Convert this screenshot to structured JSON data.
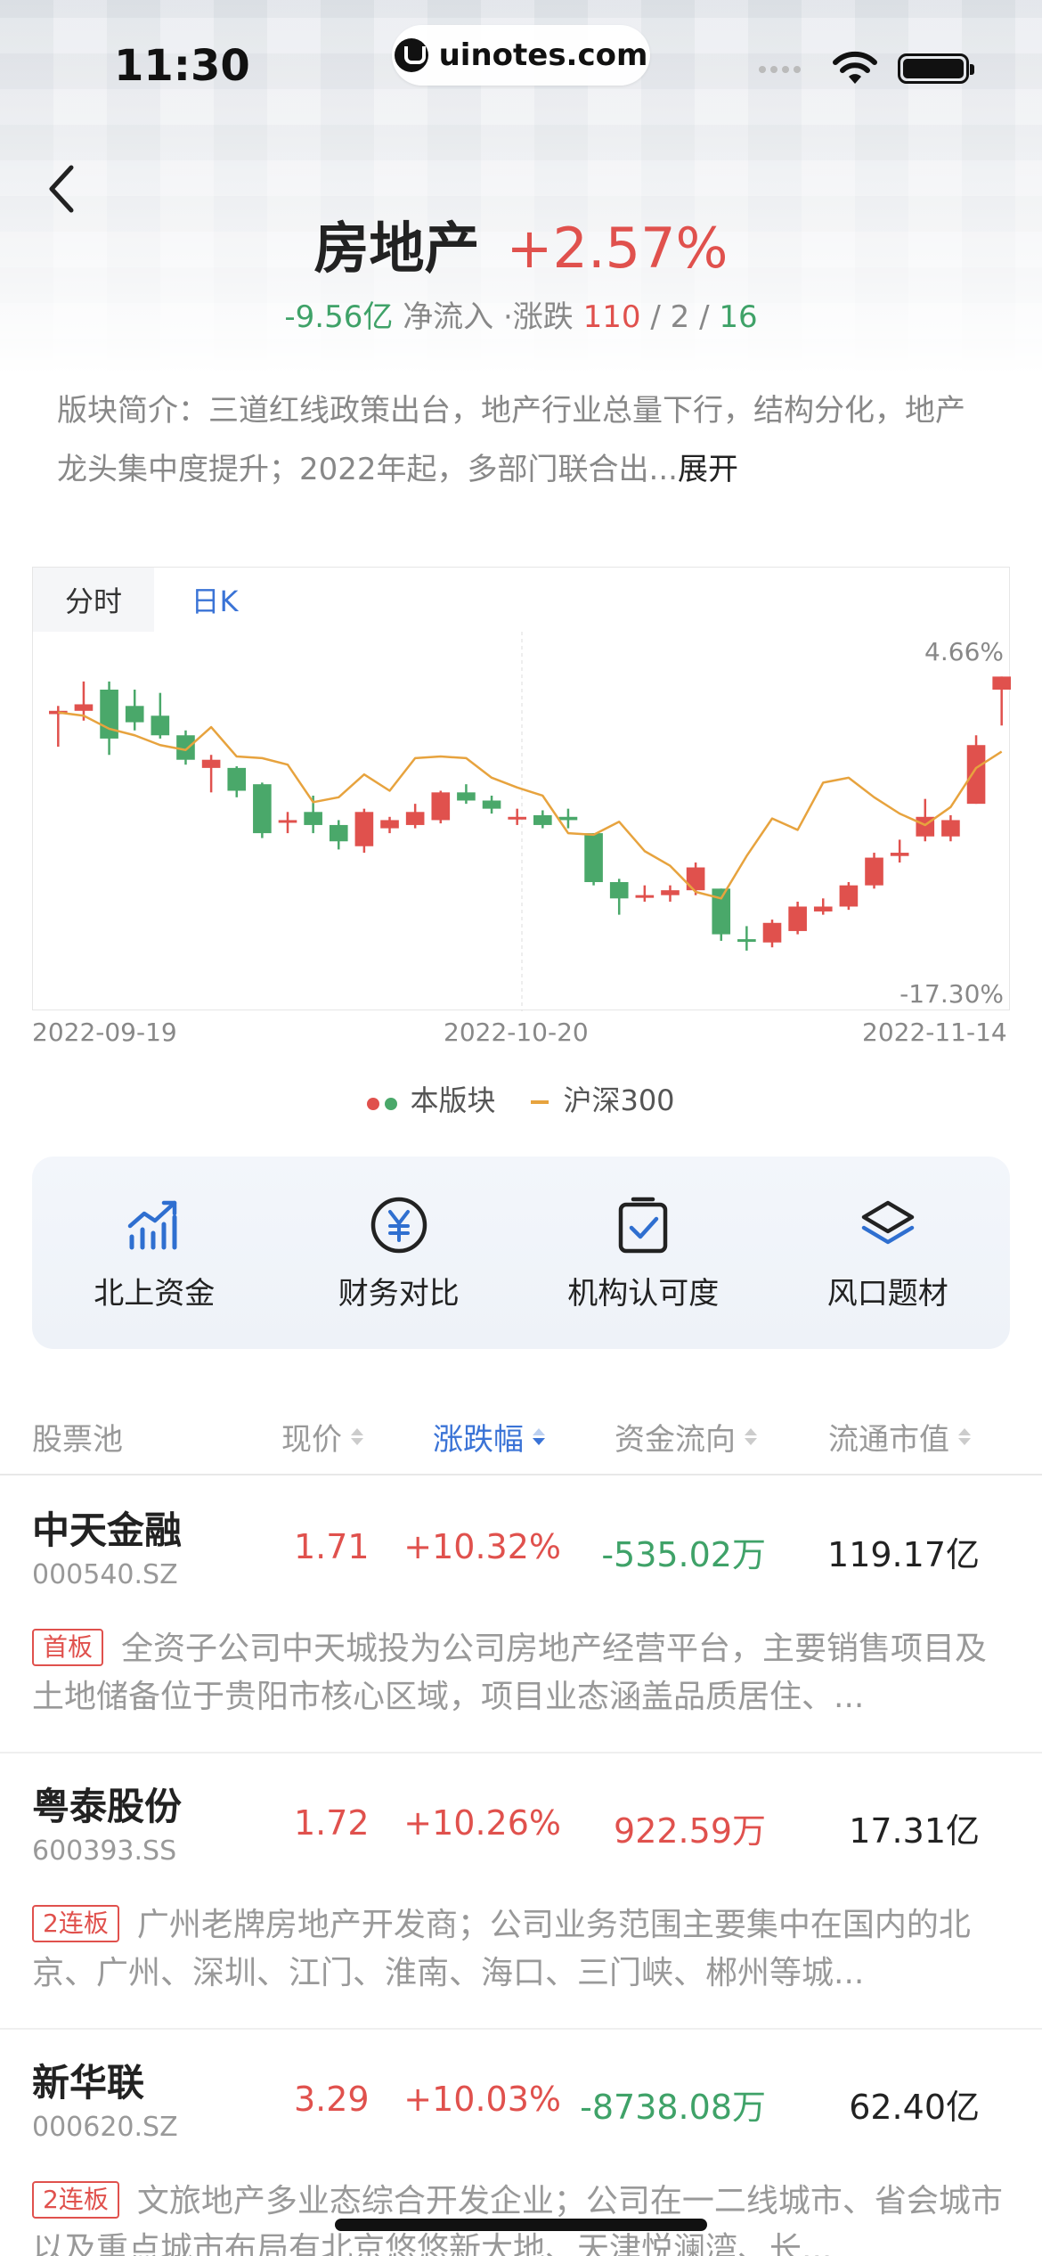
{
  "status_bar": {
    "time": "11:30",
    "url": "uinotes.com"
  },
  "header": {
    "title": "房地产",
    "change_pct": "+2.57%",
    "net_flow_value": "-9.56亿",
    "net_flow_label": "净流入",
    "updown_label": "·涨跌",
    "up_count": "110",
    "flat_count": "2",
    "down_count": "16"
  },
  "intro": {
    "text": "版块简介：三道红线政策出台，地产行业总量下行，结构分化，地产龙头集中度提升；2022年起，多部门联合出...",
    "expand_label": "展开"
  },
  "chart": {
    "tabs": [
      "分时",
      "日K"
    ],
    "active_tab": "日K",
    "max_label": "4.66%",
    "min_label": "-17.30%",
    "dates": [
      "2022-09-19",
      "2022-10-20",
      "2022-11-14"
    ],
    "legend_sector": "本版块",
    "legend_index": "沪深300",
    "colors": {
      "up": "#e0514d",
      "down": "#4aa86a",
      "index": "#e7a33e"
    }
  },
  "chart_data": {
    "type": "candlestick",
    "ylim": [
      -17.3,
      4.66
    ],
    "x_start": "2022-09-19",
    "x_mid": "2022-10-20",
    "x_end": "2022-11-14",
    "candles": [
      {
        "o": -0.5,
        "c": -0.3,
        "h": 0.0,
        "l": -2.5
      },
      {
        "o": -0.3,
        "c": 0.1,
        "h": 1.5,
        "l": -0.9
      },
      {
        "o": 1.0,
        "c": -2.0,
        "h": 1.5,
        "l": -3.0
      },
      {
        "o": 0.0,
        "c": -1.0,
        "h": 1.0,
        "l": -1.5
      },
      {
        "o": -0.6,
        "c": -1.8,
        "h": 0.8,
        "l": -2.0
      },
      {
        "o": -1.8,
        "c": -3.3,
        "h": -1.5,
        "l": -3.6
      },
      {
        "o": -3.8,
        "c": -3.3,
        "h": -3.0,
        "l": -5.3
      },
      {
        "o": -3.8,
        "c": -5.2,
        "h": -3.7,
        "l": -5.6
      },
      {
        "o": -4.8,
        "c": -7.8,
        "h": -4.7,
        "l": -8.1
      },
      {
        "o": -7.0,
        "c": -7.0,
        "h": -6.5,
        "l": -7.8
      },
      {
        "o": -6.5,
        "c": -7.3,
        "h": -5.5,
        "l": -7.8
      },
      {
        "o": -7.3,
        "c": -8.3,
        "h": -7.0,
        "l": -8.8
      },
      {
        "o": -8.6,
        "c": -6.5,
        "h": -6.3,
        "l": -9.0
      },
      {
        "o": -7.5,
        "c": -7.0,
        "h": -6.8,
        "l": -7.8
      },
      {
        "o": -7.3,
        "c": -6.5,
        "h": -6.0,
        "l": -7.5
      },
      {
        "o": -7.0,
        "c": -5.3,
        "h": -5.2,
        "l": -7.2
      },
      {
        "o": -5.3,
        "c": -5.8,
        "h": -4.8,
        "l": -6.0
      },
      {
        "o": -5.8,
        "c": -6.3,
        "h": -5.5,
        "l": -6.6
      },
      {
        "o": -6.8,
        "c": -6.8,
        "h": -6.3,
        "l": -7.3
      },
      {
        "o": -6.7,
        "c": -7.3,
        "h": -6.4,
        "l": -7.5
      },
      {
        "o": -6.8,
        "c": -7.0,
        "h": -6.3,
        "l": -7.5
      },
      {
        "o": -7.8,
        "c": -10.8,
        "h": -7.8,
        "l": -11.0
      },
      {
        "o": -10.8,
        "c": -11.8,
        "h": -10.6,
        "l": -12.8
      },
      {
        "o": -11.6,
        "c": -11.6,
        "h": -11.0,
        "l": -12.0
      },
      {
        "o": -11.6,
        "c": -11.3,
        "h": -11.0,
        "l": -12.0
      },
      {
        "o": -11.3,
        "c": -9.9,
        "h": -9.6,
        "l": -11.6
      },
      {
        "o": -11.2,
        "c": -14.0,
        "h": -11.2,
        "l": -14.4
      },
      {
        "o": -14.3,
        "c": -14.4,
        "h": -13.5,
        "l": -15.0
      },
      {
        "o": -14.5,
        "c": -13.3,
        "h": -13.1,
        "l": -14.8
      },
      {
        "o": -13.8,
        "c": -12.3,
        "h": -12.0,
        "l": -14.0
      },
      {
        "o": -12.6,
        "c": -12.3,
        "h": -11.8,
        "l": -12.8
      },
      {
        "o": -12.3,
        "c": -11.0,
        "h": -10.8,
        "l": -12.5
      },
      {
        "o": -11.0,
        "c": -9.3,
        "h": -9.0,
        "l": -11.2
      },
      {
        "o": -9.2,
        "c": -9.0,
        "h": -8.2,
        "l": -9.6
      },
      {
        "o": -8.0,
        "c": -6.8,
        "h": -5.7,
        "l": -8.3
      },
      {
        "o": -8.0,
        "c": -7.0,
        "h": -6.7,
        "l": -8.3
      },
      {
        "o": -6.0,
        "c": -2.4,
        "h": -1.8,
        "l": -6.0
      },
      {
        "o": 1.0,
        "c": 1.8,
        "h": 1.8,
        "l": -1.2
      }
    ],
    "index_line": [
      -0.4,
      -0.6,
      -1.4,
      -1.8,
      -2.4,
      -2.7,
      -1.3,
      -3.1,
      -3.2,
      -3.6,
      -5.9,
      -5.6,
      -4.2,
      -5.2,
      -3.2,
      -3.1,
      -3.2,
      -4.4,
      -5.0,
      -5.5,
      -7.8,
      -7.9,
      -7.1,
      -8.9,
      -9.8,
      -11.4,
      -11.8,
      -9.2,
      -6.9,
      -7.6,
      -4.7,
      -4.4,
      -5.6,
      -6.6,
      -7.3,
      -6.2,
      -3.8,
      -2.8
    ]
  },
  "features": [
    {
      "label": "北上资金",
      "icon": "trend-chart-icon"
    },
    {
      "label": "财务对比",
      "icon": "yuan-circle-icon"
    },
    {
      "label": "机构认可度",
      "icon": "clipboard-check-icon"
    },
    {
      "label": "风口题材",
      "icon": "layers-icon"
    }
  ],
  "table": {
    "headers": {
      "pool": "股票池",
      "price": "现价",
      "change": "涨跌幅",
      "flow": "资金流向",
      "cap": "流通市值"
    },
    "rows": [
      {
        "name": "中天金融",
        "code": "000540.SZ",
        "price": "1.71",
        "change": "+10.32%",
        "flow": "-535.02万",
        "flow_dir": "out",
        "cap": "119.17亿",
        "tag": "首板",
        "desc": "全资子公司中天城投为公司房地产经营平台，主要销售项目及土地储备位于贵阳市核心区域，项目业态涵盖品质居住、..."
      },
      {
        "name": "粤泰股份",
        "code": "600393.SS",
        "price": "1.72",
        "change": "+10.26%",
        "flow": "922.59万",
        "flow_dir": "in",
        "cap": "17.31亿",
        "tag": "2连板",
        "desc": "广州老牌房地产开发商；公司业务范围主要集中在国内的北京、广州、深圳、江门、淮南、海口、三门峡、郴州等城..."
      },
      {
        "name": "新华联",
        "code": "000620.SZ",
        "price": "3.29",
        "change": "+10.03%",
        "flow": "-8738.08万",
        "flow_dir": "out",
        "cap": "62.40亿",
        "tag": "2连板",
        "desc": "文旅地产多业态综合开发企业；公司在一二线城市、省会城市以及重点城市布局有北京悠悠新大地、天津悦澜湾、长..."
      }
    ]
  }
}
